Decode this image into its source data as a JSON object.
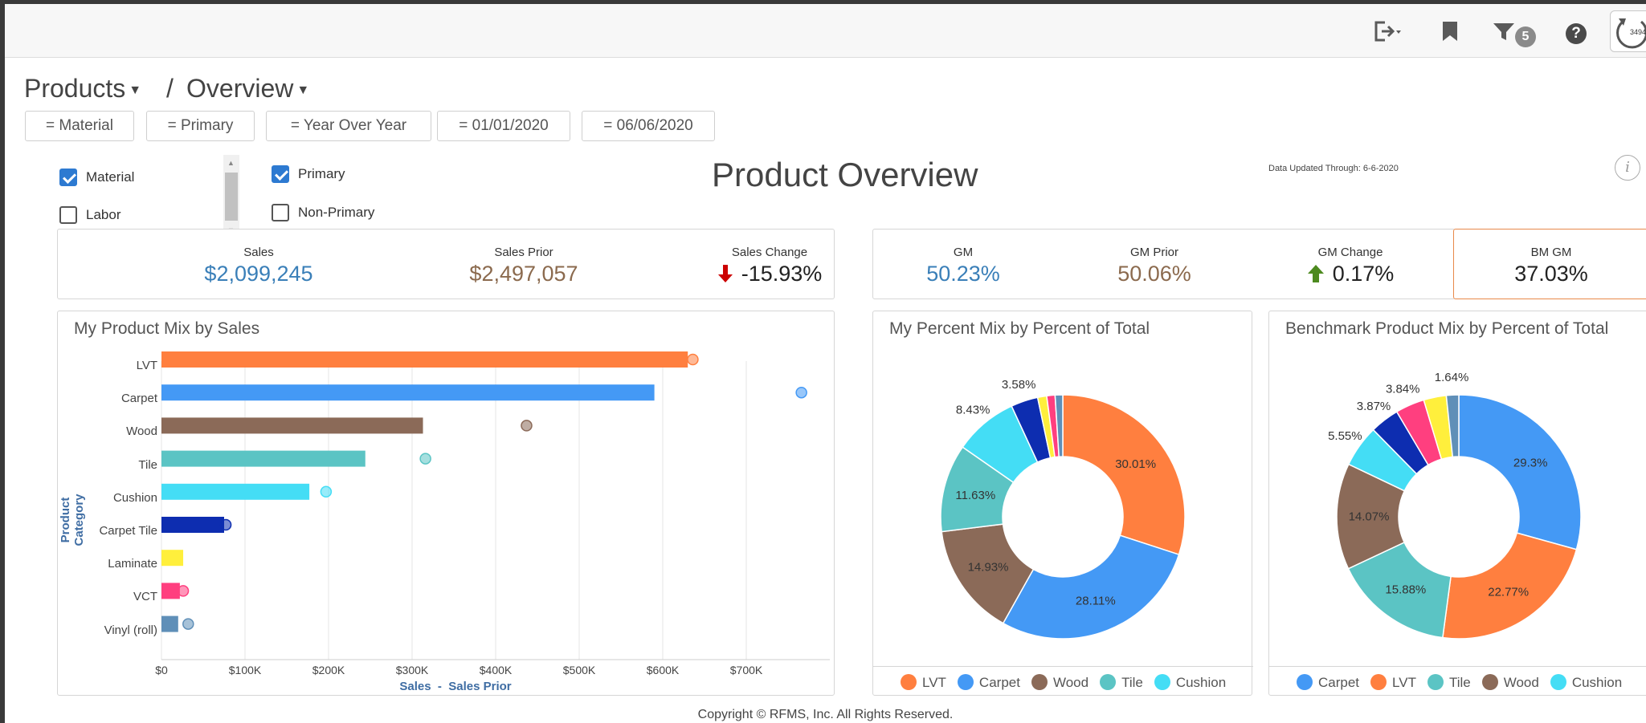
{
  "toolbar": {
    "filter_count": "5",
    "refresh_count": "3494",
    "icons": [
      "sign-out-icon",
      "bookmark-icon",
      "filter-icon",
      "help-icon",
      "refresh-icon"
    ]
  },
  "breadcrumb": {
    "section": "Products",
    "separator": "/",
    "page": "Overview"
  },
  "filter_chips": [
    "= Material",
    "= Primary",
    "= Year Over Year",
    "= 01/01/2020",
    "= 06/06/2020"
  ],
  "checkboxes": {
    "group1": [
      {
        "label": "Material",
        "checked": true
      },
      {
        "label": "Labor",
        "checked": false
      }
    ],
    "group2": [
      {
        "label": "Primary",
        "checked": true
      },
      {
        "label": "Non-Primary",
        "checked": false
      }
    ]
  },
  "page_title": "Product Overview",
  "data_updated": "Data Updated Through: 6-6-2020",
  "kpis_sales": {
    "sales_label": "Sales",
    "sales_value": "$2,099,245",
    "prior_label": "Sales Prior",
    "prior_value": "$2,497,057",
    "change_label": "Sales Change",
    "change_value": "-15.93%",
    "change_direction": "down"
  },
  "kpis_gm": {
    "gm_label": "GM",
    "gm_value": "50.23%",
    "prior_label": "GM Prior",
    "prior_value": "50.06%",
    "change_label": "GM Change",
    "change_value": "0.17%",
    "change_direction": "up",
    "bm_label": "BM GM",
    "bm_value": "37.03%"
  },
  "colors": {
    "sales_blue": "#3a7fb8",
    "prior_brown": "#8b6a4e",
    "down_red": "#cc0000",
    "up_green": "#4d8a1f",
    "bm_border": "#e8894a"
  },
  "footer": "Copyright © RFMS, Inc.  All Rights Reserved.",
  "chart_data": [
    {
      "type": "bar",
      "orientation": "horizontal",
      "title": "My Product Mix by Sales",
      "ylabel": "Product Category",
      "xlabel": "Sales  -  Sales Prior",
      "categories": [
        "LVT",
        "Carpet",
        "Wood",
        "Tile",
        "Cushion",
        "Carpet Tile",
        "Laminate",
        "VCT",
        "Vinyl (roll)"
      ],
      "colors": [
        "#ff7f3f",
        "#4499f5",
        "#8b6a58",
        "#5bc4c4",
        "#44ddf5",
        "#0d2db0",
        "#ffef3c",
        "#ff3f7f",
        "#5f8fb8"
      ],
      "series": [
        {
          "name": "Sales",
          "values": [
            630000,
            590000,
            313000,
            244000,
            177000,
            75000,
            26000,
            22000,
            20000
          ]
        },
        {
          "name": "Sales Prior",
          "values": [
            636000,
            766000,
            437000,
            316000,
            197000,
            77000,
            null,
            26000,
            32000
          ]
        }
      ],
      "xlim": [
        0,
        800000
      ],
      "xticks": [
        "$0",
        "$100K",
        "$200K",
        "$300K",
        "$400K",
        "$500K",
        "$600K",
        "$700K"
      ],
      "grid": true
    },
    {
      "type": "pie",
      "donut": true,
      "title": "My Percent Mix by Percent of Total",
      "labels": [
        "LVT",
        "Carpet",
        "Wood",
        "Tile",
        "Cushion",
        "Carpet Tile",
        "Laminate",
        "VCT",
        "Vinyl (roll)"
      ],
      "values": [
        30.01,
        28.11,
        14.93,
        11.63,
        8.43,
        3.58,
        1.2,
        1.1,
        1.01
      ],
      "shown_labels": [
        "30.01%",
        "28.11%",
        "14.93%",
        "11.63%",
        "8.43%",
        "3.58%",
        "",
        "",
        ""
      ],
      "colors": [
        "#ff7f3f",
        "#4499f5",
        "#8b6a58",
        "#5bc4c4",
        "#44ddf5",
        "#0d2db0",
        "#ffef3c",
        "#ff3f7f",
        "#5f8fb8"
      ],
      "legend": [
        "LVT",
        "Carpet",
        "Wood",
        "Tile",
        "Cushion"
      ],
      "legend_position": "bottom"
    },
    {
      "type": "pie",
      "donut": true,
      "title": "Benchmark Product Mix by Percent of Total",
      "labels": [
        "Carpet",
        "LVT",
        "Tile",
        "Wood",
        "Cushion",
        "Carpet Tile",
        "VCT",
        "Laminate",
        "Vinyl (roll)"
      ],
      "values": [
        29.3,
        22.77,
        15.88,
        14.07,
        5.55,
        3.87,
        3.84,
        3.0,
        1.64
      ],
      "shown_labels": [
        "29.3%",
        "22.77%",
        "15.88%",
        "14.07%",
        "5.55%",
        "3.87%",
        "3.84%",
        "",
        "1.64%"
      ],
      "colors": [
        "#4499f5",
        "#ff7f3f",
        "#5bc4c4",
        "#8b6a58",
        "#44ddf5",
        "#0d2db0",
        "#ff3f7f",
        "#ffef3c",
        "#5f8fb8"
      ],
      "legend": [
        "Carpet",
        "LVT",
        "Tile",
        "Wood",
        "Cushion"
      ],
      "legend_position": "bottom"
    }
  ]
}
